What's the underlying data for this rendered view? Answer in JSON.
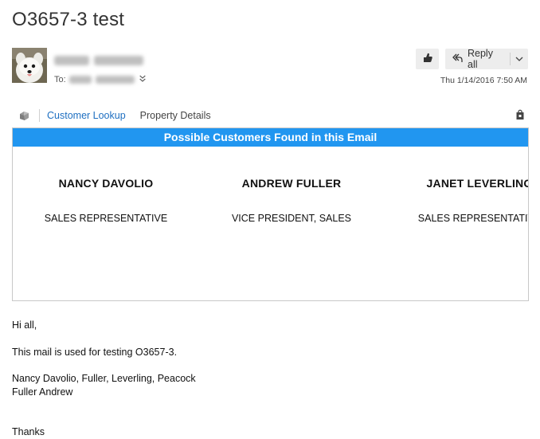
{
  "email": {
    "subject": "O3657-3 test",
    "to_label": "To:",
    "timestamp": "Thu 1/14/2016 7:50 AM"
  },
  "toolbar": {
    "reply_all_label": "Reply all"
  },
  "addin": {
    "tabs": [
      {
        "label": "Customer Lookup",
        "active": true
      },
      {
        "label": "Property Details",
        "active": false
      }
    ],
    "panel_header": "Possible Customers Found in this Email",
    "customers": [
      {
        "name": "NANCY DAVOLIO",
        "title": "SALES REPRESENTATIVE"
      },
      {
        "name": "ANDREW FULLER",
        "title": "VICE PRESIDENT, SALES"
      },
      {
        "name": "JANET LEVERLING",
        "title": "SALES REPRESENTATIVE"
      }
    ]
  },
  "body": {
    "greeting": "Hi all,",
    "line1": "This mail is used for testing O3657-3.",
    "line2": "Nancy Davolio, Fuller, Leverling, Peacock",
    "line3": "Fuller Andrew",
    "closing": "Thanks"
  },
  "icons": {
    "like": "like-icon",
    "reply_all": "reply-all-icon",
    "dropdown": "chevron-down-icon",
    "addin_logo": "addin-logo-icon",
    "store": "store-icon"
  },
  "colors": {
    "accent": "#2196f0",
    "active_tab": "#1e6fc1",
    "button_bg": "#ededed"
  }
}
